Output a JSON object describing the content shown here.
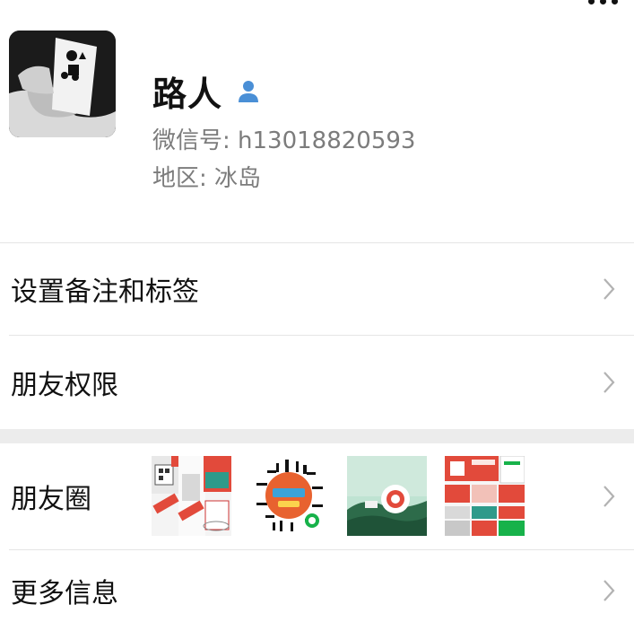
{
  "header": {
    "back_icon": "back-arrow-icon",
    "more_icon": "more-dots-icon"
  },
  "profile": {
    "name": "路人",
    "badge_icon": "person-icon",
    "wechat_id": "微信号: h13018820593",
    "region": "地区: 冰岛"
  },
  "menu": {
    "remark_tags": "设置备注和标签",
    "friend_permissions": "朋友权限",
    "moments": "朋友圈",
    "more_info": "更多信息"
  },
  "moments_thumbs": [
    "photo-1",
    "photo-2",
    "photo-3",
    "photo-4"
  ],
  "colors": {
    "accent_blue": "#4a8fd6",
    "meta_gray": "#7c7c7c",
    "divider": "#e5e5e5",
    "band": "#ececec"
  }
}
